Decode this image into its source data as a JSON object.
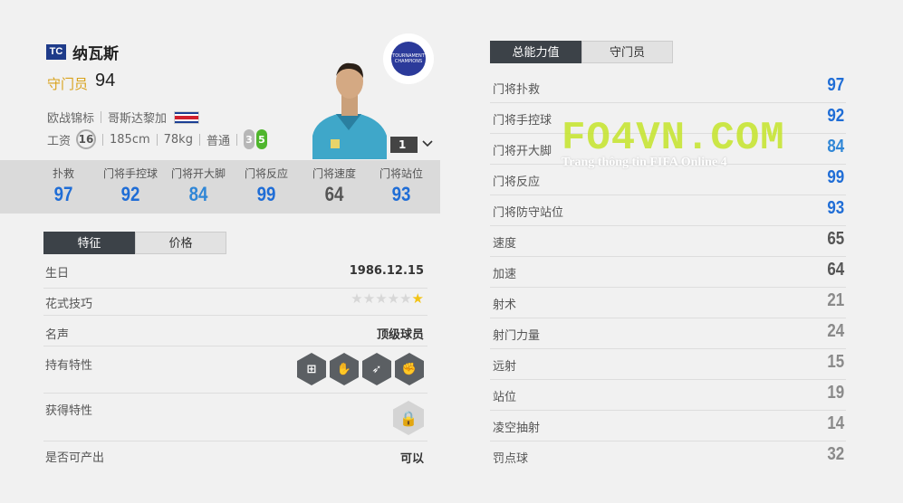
{
  "player": {
    "season_badge": "TC",
    "name": "纳瓦斯",
    "position": "守门员",
    "overall": "94",
    "league": "欧战锦标",
    "nationality": "哥斯达黎加",
    "wage_label": "工资",
    "wage": "16",
    "height": "185cm",
    "weight": "78kg",
    "body_type": "普通",
    "weak_foot": "3",
    "skill_level": "5",
    "upgrade_level": "1",
    "team_badge_text": "TOURNAMENT CHAMPIONS"
  },
  "colors": {
    "high": "#1f6dd6",
    "mid": "#2f86d6",
    "low": "#8a8a8a",
    "grey": "#555555",
    "weak_foot_pill": "#b7b7b7",
    "skill_pill": "#4fb62d"
  },
  "key_stats": [
    {
      "label": "扑救",
      "value": "97",
      "color": "#1f6dd6"
    },
    {
      "label": "门将手控球",
      "value": "92",
      "color": "#1f6dd6"
    },
    {
      "label": "门将开大脚",
      "value": "84",
      "color": "#2f86d6"
    },
    {
      "label": "门将反应",
      "value": "99",
      "color": "#1f6dd6"
    },
    {
      "label": "门将速度",
      "value": "64",
      "color": "#555555"
    },
    {
      "label": "门将站位",
      "value": "93",
      "color": "#1f6dd6"
    }
  ],
  "left_tabs": [
    "特征",
    "价格"
  ],
  "info": {
    "birthday_label": "生日",
    "birthday": "1986.12.15",
    "skill_moves_label": "花式技巧",
    "skill_moves_stars": 1,
    "reputation_label": "名声",
    "reputation": "顶级球员",
    "traits_label": "持有特性",
    "trait_icons": [
      "goalkeeper-net-icon",
      "goalkeeper-glove-icon",
      "goalkeeper-dive-icon",
      "goalkeeper-hand-icon"
    ],
    "acquired_label": "获得特性",
    "sellable_label": "是否可产出",
    "sellable": "可以"
  },
  "right_tabs": [
    "总能力值",
    "守门员"
  ],
  "attributes": [
    {
      "label": "门将扑救",
      "value": "97",
      "color": "#1f6dd6"
    },
    {
      "label": "门将手控球",
      "value": "92",
      "color": "#1f6dd6"
    },
    {
      "label": "门将开大脚",
      "value": "84",
      "color": "#2f86d6"
    },
    {
      "label": "门将反应",
      "value": "99",
      "color": "#1f6dd6"
    },
    {
      "label": "门将防守站位",
      "value": "93",
      "color": "#1f6dd6"
    },
    {
      "label": "速度",
      "value": "65",
      "color": "#555555"
    },
    {
      "label": "加速",
      "value": "64",
      "color": "#555555"
    },
    {
      "label": "射术",
      "value": "21",
      "color": "#8a8a8a"
    },
    {
      "label": "射门力量",
      "value": "24",
      "color": "#8a8a8a"
    },
    {
      "label": "远射",
      "value": "15",
      "color": "#8a8a8a"
    },
    {
      "label": "站位",
      "value": "19",
      "color": "#8a8a8a"
    },
    {
      "label": "凌空抽射",
      "value": "14",
      "color": "#8a8a8a"
    },
    {
      "label": "罚点球",
      "value": "32",
      "color": "#8a8a8a"
    }
  ],
  "watermark": {
    "title": "FO4VN.COM",
    "subtitle": "Trang thông tin FIFA Online 4"
  }
}
